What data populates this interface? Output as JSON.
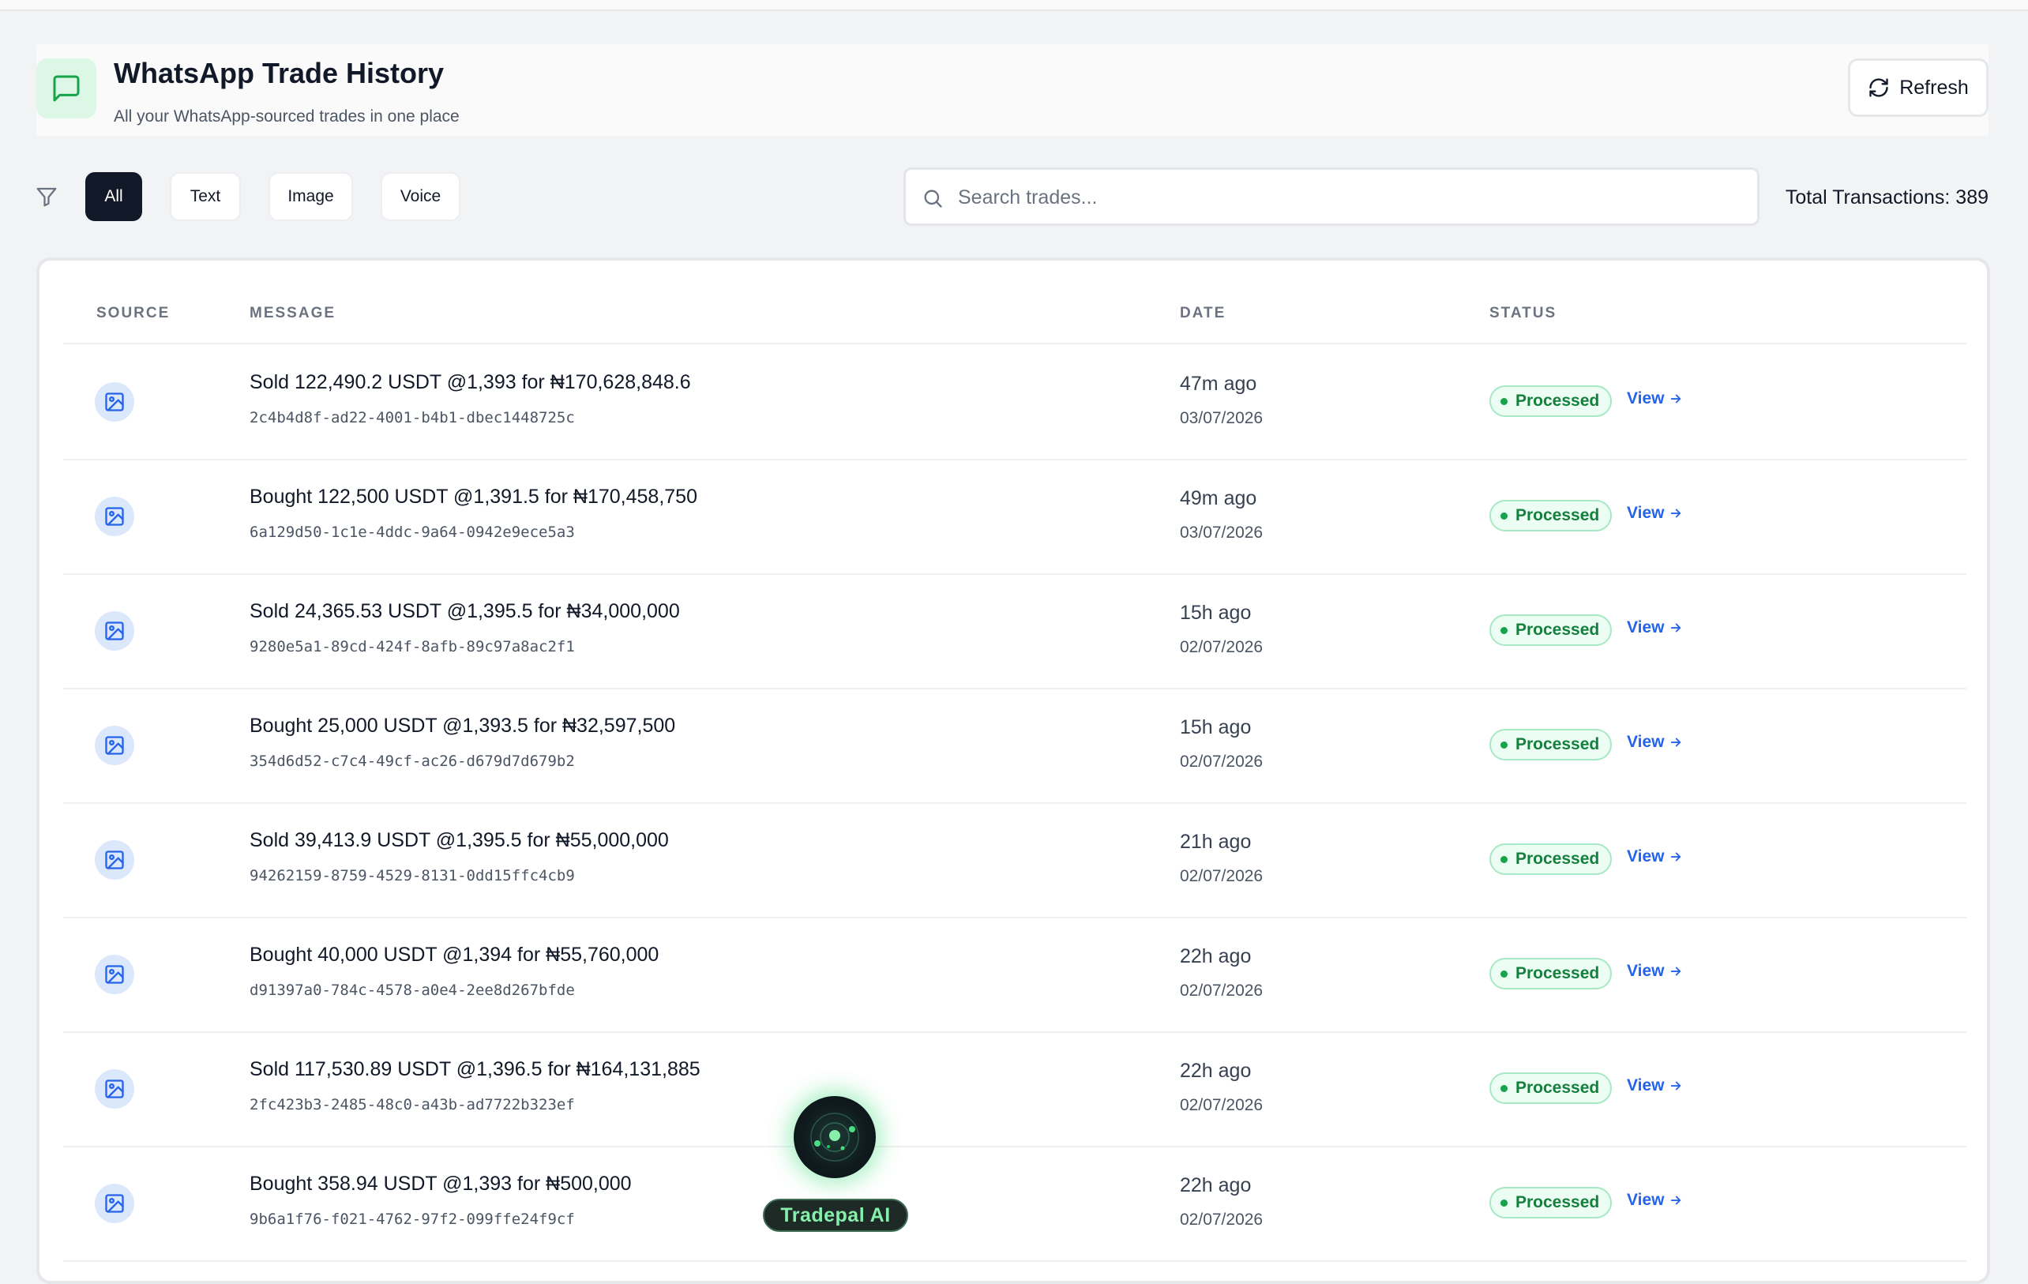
{
  "header": {
    "title": "WhatsApp Trade History",
    "subtitle": "All your WhatsApp-sourced trades in one place",
    "refresh_label": "Refresh"
  },
  "filters": {
    "chips": [
      "All",
      "Text",
      "Image",
      "Voice"
    ],
    "active": "All"
  },
  "search": {
    "placeholder": "Search trades...",
    "value": ""
  },
  "total_label": "Total Transactions: 389",
  "table": {
    "columns": [
      "SOURCE",
      "MESSAGE",
      "DATE",
      "STATUS"
    ],
    "rows": [
      {
        "message": "Sold 122,490.2 USDT @1,393 for ₦170,628,848.6",
        "id": "2c4b4d8f-ad22-4001-b4b1-dbec1448725c",
        "relative": "47m ago",
        "date": "03/07/2026",
        "status": "Processed",
        "action": "View"
      },
      {
        "message": "Bought 122,500 USDT @1,391.5 for ₦170,458,750",
        "id": "6a129d50-1c1e-4ddc-9a64-0942e9ece5a3",
        "relative": "49m ago",
        "date": "03/07/2026",
        "status": "Processed",
        "action": "View"
      },
      {
        "message": "Sold 24,365.53 USDT @1,395.5 for ₦34,000,000",
        "id": "9280e5a1-89cd-424f-8afb-89c97a8ac2f1",
        "relative": "15h ago",
        "date": "02/07/2026",
        "status": "Processed",
        "action": "View"
      },
      {
        "message": "Bought 25,000 USDT @1,393.5 for ₦32,597,500",
        "id": "354d6d52-c7c4-49cf-ac26-d679d7d679b2",
        "relative": "15h ago",
        "date": "02/07/2026",
        "status": "Processed",
        "action": "View"
      },
      {
        "message": "Sold 39,413.9 USDT @1,395.5 for ₦55,000,000",
        "id": "94262159-8759-4529-8131-0dd15ffc4cb9",
        "relative": "21h ago",
        "date": "02/07/2026",
        "status": "Processed",
        "action": "View"
      },
      {
        "message": "Bought 40,000 USDT @1,394 for ₦55,760,000",
        "id": "d91397a0-784c-4578-a0e4-2ee8d267bfde",
        "relative": "22h ago",
        "date": "02/07/2026",
        "status": "Processed",
        "action": "View"
      },
      {
        "message": "Sold 117,530.89 USDT @1,396.5 for ₦164,131,885",
        "id": "2fc423b3-2485-48c0-a43b-ad7722b323ef",
        "relative": "22h ago",
        "date": "02/07/2026",
        "status": "Processed",
        "action": "View"
      },
      {
        "message": "Bought 358.94 USDT @1,393 for ₦500,000",
        "id": "9b6a1f76-f021-4762-97f2-099ffe24f9cf",
        "relative": "22h ago",
        "date": "02/07/2026",
        "status": "Processed",
        "action": "View"
      }
    ]
  },
  "assistant": {
    "label": "Tradepal AI"
  },
  "icons": {
    "header": "message-square-icon",
    "refresh": "refresh-icon",
    "filter": "filter-icon",
    "search": "search-icon",
    "source": "image-icon",
    "view": "arrow-right-icon"
  },
  "colors": {
    "accent_green": "#16a34a",
    "link_blue": "#2563eb",
    "active_chip": "#111827",
    "icon_bg_blue": "#dbe7fb"
  }
}
